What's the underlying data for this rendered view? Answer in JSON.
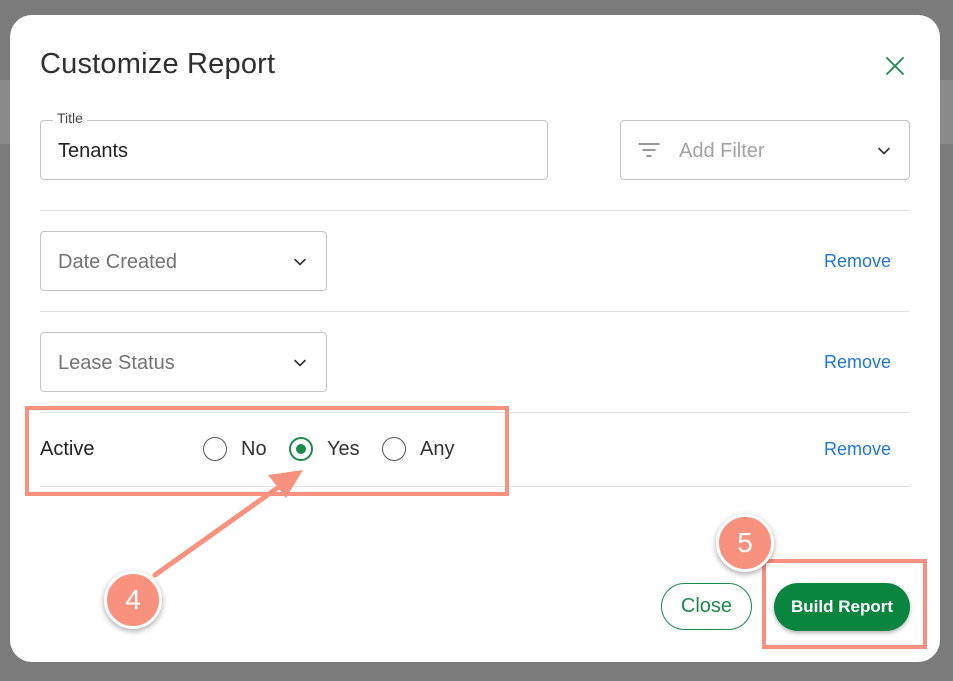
{
  "dialog": {
    "title": "Customize Report"
  },
  "title_field": {
    "label": "Title",
    "value": "Tenants"
  },
  "filter_select": {
    "placeholder": "Add Filter"
  },
  "filters": [
    {
      "label": "Date Created",
      "remove_label": "Remove"
    },
    {
      "label": "Lease Status",
      "remove_label": "Remove"
    }
  ],
  "active_filter": {
    "label": "Active",
    "options": [
      "No",
      "Yes",
      "Any"
    ],
    "selected": "Yes",
    "remove_label": "Remove"
  },
  "footer": {
    "close_label": "Close",
    "build_label": "Build Report"
  },
  "annotations": {
    "step_4": "4",
    "step_5": "5"
  },
  "colors": {
    "accent_green": "#0a8540",
    "link_blue": "#1e76d2",
    "highlight_salmon": "#f9917f"
  },
  "icons": [
    "close-icon",
    "filter-icon",
    "chevron-down-icon"
  ]
}
